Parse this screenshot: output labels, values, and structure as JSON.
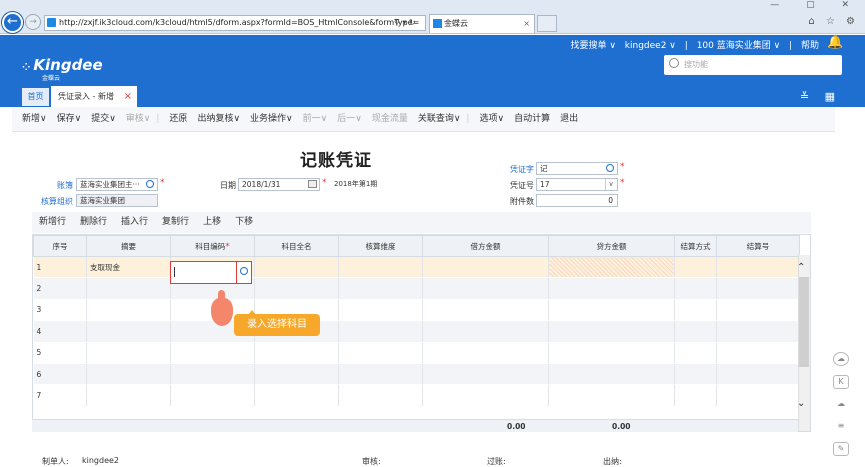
{
  "browser": {
    "url": "http://zxjf.ik3cloud.com/k3cloud/html5/dform.aspx?formId=BOS_HtmlConsole&formType=",
    "url_tools": "⚲ ▾ ↻",
    "tab_title": "金蝶云",
    "tab_close": "×",
    "window_controls": "— ▢ ✕",
    "tools": "⌂ ☆ ⚙"
  },
  "app": {
    "logo": "Kingdee",
    "logo_sub": "金蝶云",
    "nav": [
      "找要搜单 ∨",
      "kingdee2 ∨",
      "|",
      "100 蓝海实业集团 ∨",
      "|",
      "帮助"
    ],
    "search_placeholder": "搜功能",
    "tab_home": "首页",
    "tab_voucher": "凭证录入 - 新增",
    "tab_voucher_close": "×",
    "header_right": "≚ ▦"
  },
  "toolbar": {
    "items": [
      {
        "label": "新增∨",
        "enabled": true
      },
      {
        "label": "保存∨",
        "enabled": true
      },
      {
        "label": "提交∨",
        "enabled": true
      },
      {
        "label": "审核∨",
        "enabled": false
      },
      {
        "label": "|",
        "enabled": false
      },
      {
        "label": "还原",
        "enabled": true
      },
      {
        "label": "出纳复核∨",
        "enabled": true
      },
      {
        "label": "业务操作∨",
        "enabled": true
      },
      {
        "label": "前一∨",
        "enabled": false
      },
      {
        "label": "后一∨",
        "enabled": false
      },
      {
        "label": "现金流量",
        "enabled": false
      },
      {
        "label": "关联查询∨",
        "enabled": true
      },
      {
        "label": "|",
        "enabled": false
      },
      {
        "label": "选项∨",
        "enabled": true
      },
      {
        "label": "自动计算",
        "enabled": true
      },
      {
        "label": "退出",
        "enabled": true
      }
    ]
  },
  "form": {
    "title": "记账凭证",
    "book_label": "账簿",
    "book_value": "蓝海实业集团主···",
    "org_label": "核算组织",
    "org_value": "蓝海实业集团",
    "date_label": "日期",
    "date_value": "2018/1/31",
    "period_text": "2018年第1期",
    "vword_label": "凭证字",
    "vword_value": "记",
    "vno_label": "凭证号",
    "vno_value": "17",
    "attach_label": "附件数",
    "attach_value": "0",
    "required_mark": "*"
  },
  "grid": {
    "actions": [
      "新增行",
      "删除行",
      "插入行",
      "复制行",
      "上移",
      "下移"
    ],
    "columns": [
      "序号",
      "摘要",
      "科目编码",
      "科目全名",
      "核算维度",
      "借方金额",
      "贷方金额",
      "结算方式",
      "结算号"
    ],
    "rows": [
      [
        "1",
        "支取现金",
        "",
        "",
        "",
        "",
        "",
        "",
        ""
      ],
      [
        "2",
        "",
        "",
        "",
        "",
        "",
        "",
        "",
        ""
      ],
      [
        "3",
        "",
        "",
        "",
        "",
        "",
        "",
        "",
        ""
      ],
      [
        "4",
        "",
        "",
        "",
        "",
        "",
        "",
        "",
        ""
      ],
      [
        "5",
        "",
        "",
        "",
        "",
        "",
        "",
        "",
        ""
      ],
      [
        "6",
        "",
        "",
        "",
        "",
        "",
        "",
        "",
        ""
      ],
      [
        "7",
        "",
        "",
        "",
        "",
        "",
        "",
        "",
        ""
      ]
    ],
    "debit_total": "0.00",
    "credit_total": "0.00",
    "scroll_up": "⌃",
    "scroll_down": "⌄"
  },
  "tooltip": "录入选择科目",
  "footer": {
    "maker_label": "制单人:",
    "maker_value": "kingdee2",
    "audit_label": "审核:",
    "post_label": "过账:",
    "cashier_label": "出纳:"
  },
  "side_icons": [
    "cloud-icon",
    "k-icon",
    "cloud-outline-icon",
    "database-icon",
    "edit-icon"
  ],
  "colors": {
    "brand": "#1f6fd1",
    "accent": "#f7a82a",
    "required": "#e53935"
  }
}
